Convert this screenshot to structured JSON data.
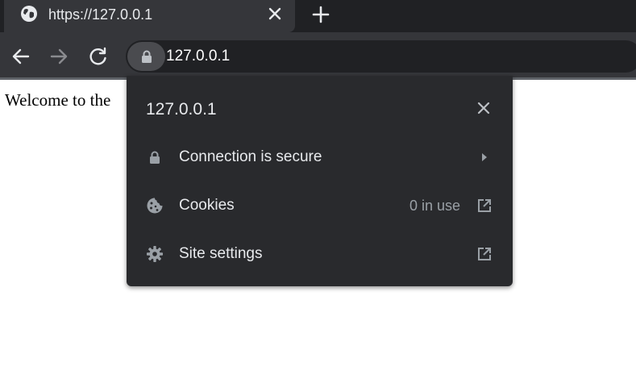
{
  "tab": {
    "title": "https://127.0.0.1",
    "favicon": "globe-icon"
  },
  "toolbar": {
    "url": "127.0.0.1",
    "icons": [
      "back-arrow-icon",
      "forward-arrow-icon",
      "reload-icon",
      "lock-icon"
    ]
  },
  "page": {
    "text": "Welcome to the"
  },
  "popup": {
    "title": "127.0.0.1",
    "rows": [
      {
        "label": "Connection is secure",
        "icon": "lock-icon",
        "trailing": "arrow-right-icon"
      },
      {
        "label": "Cookies",
        "status": "0 in use",
        "icon": "cookie-icon",
        "trailing": "external-link-icon"
      },
      {
        "label": "Site settings",
        "icon": "gear-icon",
        "trailing": "external-link-icon"
      }
    ]
  },
  "colors": {
    "tabstrip_bg": "#202124",
    "toolbar_bg": "#35363a",
    "popup_bg": "#292a2d",
    "text_primary": "#e8eaed",
    "text_secondary": "#9aa0a6"
  }
}
